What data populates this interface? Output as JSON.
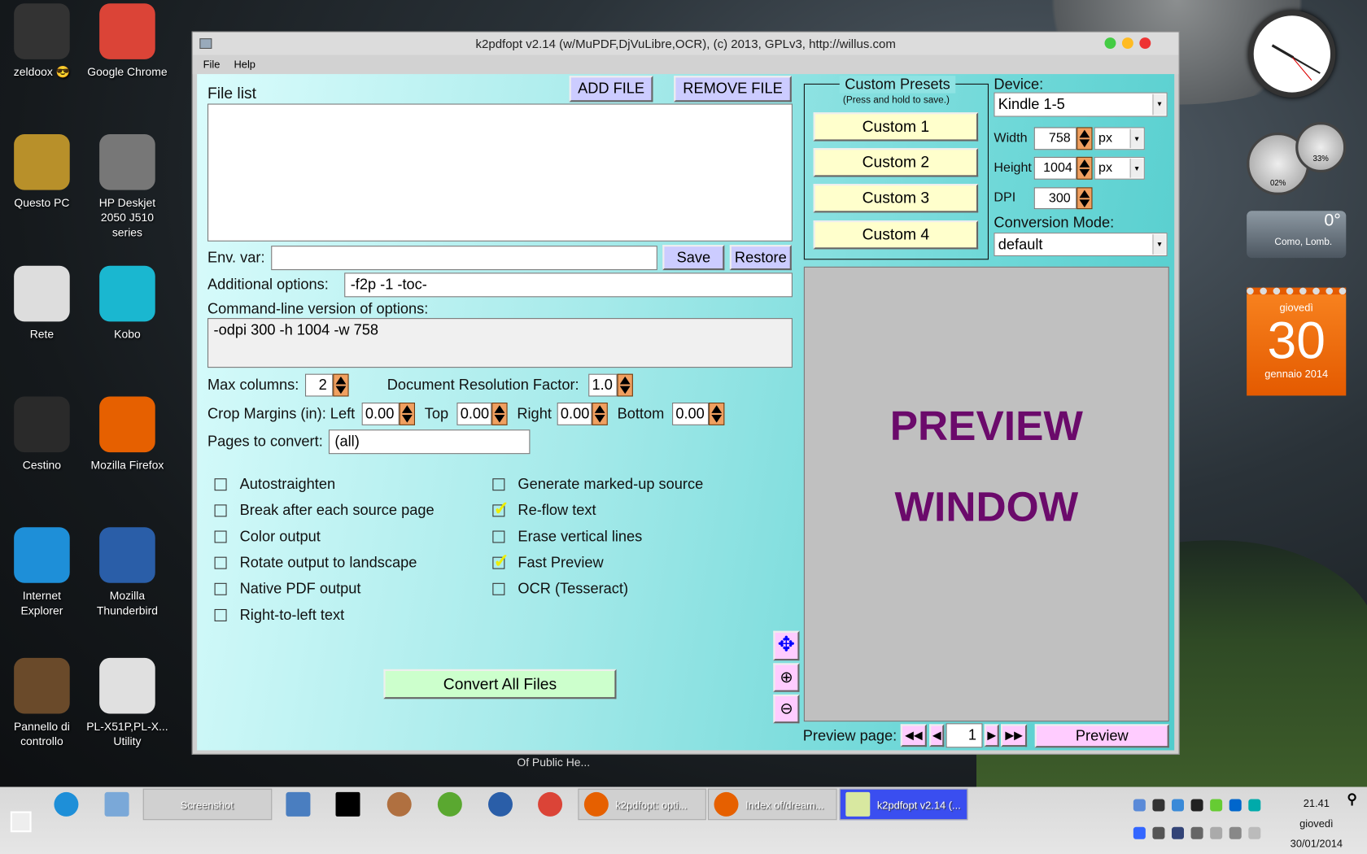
{
  "desktop": {
    "icons": [
      {
        "label": "zeldoox 😎",
        "color": "#333"
      },
      {
        "label": "Google Chrome",
        "color": "#db4437"
      },
      {
        "label": "Questo PC",
        "color": "#b8902a"
      },
      {
        "label": "HP Deskjet 2050 J510 series",
        "color": "#777"
      },
      {
        "label": "Rete",
        "color": "#ddd"
      },
      {
        "label": "Kobo",
        "color": "#1ab7d0"
      },
      {
        "label": "Cestino",
        "color": "#2a2a2a"
      },
      {
        "label": "Mozilla Firefox",
        "color": "#e66000"
      },
      {
        "label": "Internet Explorer",
        "color": "#1e8fd8"
      },
      {
        "label": "Mozilla Thunderbird",
        "color": "#2a5ea8"
      },
      {
        "label": "Pannello di controllo",
        "color": "#6a4a2a"
      },
      {
        "label": "PL-X51P,PL-X... Utility",
        "color": "#e0e0e0"
      }
    ],
    "hidden_label": "Of Public He...",
    "calendar": {
      "day_name": "giovedì",
      "day": "30",
      "month_year": "gennaio 2014"
    },
    "weather": {
      "temp": "0°",
      "place": "Como, Lomb."
    },
    "meters": {
      "cpu": "02%",
      "mem": "33%"
    }
  },
  "window": {
    "title": "k2pdfopt v2.14 (w/MuPDF,DjVuLibre,OCR), (c) 2013, GPLv3, http://willus.com",
    "menu": [
      "File",
      "Help"
    ],
    "file_list_label": "File list",
    "add_file": "ADD FILE",
    "remove_file": "REMOVE FILE",
    "env_var_label": "Env. var:",
    "env_var_value": "",
    "save": "Save",
    "restore": "Restore",
    "additional_options_label": "Additional options:",
    "additional_options_value": "-f2p -1 -toc-",
    "cmdline_label": "Command-line version of options:",
    "cmdline_value": "-odpi 300 -h 1004 -w 758",
    "max_columns_label": "Max columns:",
    "max_columns": "2",
    "drf_label": "Document Resolution Factor:",
    "drf": "1.0",
    "crop_label": "Crop Margins (in): Left",
    "crop_left": "0.00",
    "top_label": "Top",
    "crop_top": "0.00",
    "right_label": "Right",
    "crop_right": "0.00",
    "bottom_label": "Bottom",
    "crop_bottom": "0.00",
    "pages_label": "Pages to convert:",
    "pages_value": "(all)",
    "checkboxes_left": [
      {
        "label": "Autostraighten",
        "checked": false
      },
      {
        "label": "Break after each source page",
        "checked": false
      },
      {
        "label": "Color output",
        "checked": false
      },
      {
        "label": "Rotate output to landscape",
        "checked": false
      },
      {
        "label": "Native PDF output",
        "checked": false
      },
      {
        "label": "Right-to-left text",
        "checked": false
      }
    ],
    "checkboxes_right": [
      {
        "label": "Generate marked-up source",
        "checked": false
      },
      {
        "label": "Re-flow text",
        "checked": true
      },
      {
        "label": "Erase vertical lines",
        "checked": false
      },
      {
        "label": "Fast Preview",
        "checked": true
      },
      {
        "label": "OCR (Tesseract)",
        "checked": false
      }
    ],
    "convert": "Convert All Files",
    "presets": {
      "title": "Custom Presets",
      "hint": "(Press and hold to save.)",
      "buttons": [
        "Custom 1",
        "Custom 2",
        "Custom 3",
        "Custom 4"
      ]
    },
    "device_label": "Device:",
    "device": "Kindle 1-5",
    "width_label": "Width",
    "width": "758",
    "width_unit": "px",
    "height_label": "Height",
    "height": "1004",
    "height_unit": "px",
    "dpi_label": "DPI",
    "dpi": "300",
    "mode_label": "Conversion Mode:",
    "mode": "default",
    "preview_line1": "PREVIEW",
    "preview_line2": "WINDOW",
    "preview_page_label": "Preview page:",
    "preview_page": "1",
    "preview_button": "Preview"
  },
  "taskbar": {
    "items": [
      "Screenshot",
      "k2pdfopt: opti...",
      "Index of/dream...",
      "k2pdfopt v2.14 (..."
    ],
    "time": "21.41",
    "day": "giovedì",
    "date": "30/01/2014",
    "active_color": "#3a4ef0"
  }
}
